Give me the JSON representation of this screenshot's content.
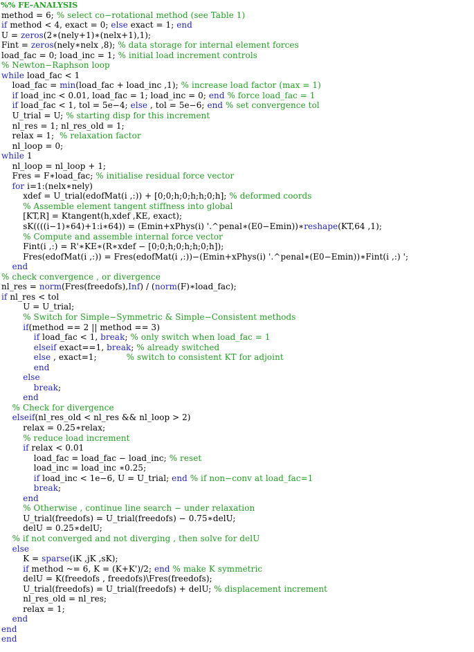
{
  "document": {
    "kind": "matlab-code-listing",
    "language": "MATLAB",
    "background_color": "#ffffff",
    "colors": {
      "plain": "#000000",
      "keyword": "#2222cc",
      "function": "#2222cc",
      "comment": "#1fa01f"
    },
    "cell_header": "%% FE–ANALYSIS",
    "line_count": 64
  },
  "lines": [
    {
      "indent": 0,
      "tokens": [
        {
          "t": "c",
          "v": "%% FE–ANALYSIS"
        }
      ]
    },
    {
      "indent": 0,
      "tokens": [
        {
          "t": "n",
          "v": "method = 6; "
        },
        {
          "t": "c",
          "v": "% select co−rotational method (see Table 1)"
        }
      ]
    },
    {
      "indent": 0,
      "tokens": [
        {
          "t": "k",
          "v": "if"
        },
        {
          "t": "n",
          "v": " method < 4, exact = 0; "
        },
        {
          "t": "k",
          "v": "else"
        },
        {
          "t": "n",
          "v": " exact = 1; "
        },
        {
          "t": "k",
          "v": "end"
        }
      ]
    },
    {
      "indent": 0,
      "tokens": [
        {
          "t": "n",
          "v": "U = "
        },
        {
          "t": "f",
          "v": "zeros"
        },
        {
          "t": "n",
          "v": "(2∗(nely+1)∗(nelx+1),1);"
        }
      ]
    },
    {
      "indent": 0,
      "tokens": [
        {
          "t": "n",
          "v": "Fint = "
        },
        {
          "t": "f",
          "v": "zeros"
        },
        {
          "t": "n",
          "v": "(nely∗nelx ,8); "
        },
        {
          "t": "c",
          "v": "% data storage for internal element forces"
        }
      ]
    },
    {
      "indent": 0,
      "tokens": [
        {
          "t": "n",
          "v": "load_fac = 0; load_inc = 1; "
        },
        {
          "t": "c",
          "v": "% initial load increment controls"
        }
      ]
    },
    {
      "indent": 0,
      "tokens": [
        {
          "t": "c",
          "v": "% Newton−Raphson loop"
        }
      ]
    },
    {
      "indent": 0,
      "tokens": [
        {
          "t": "k",
          "v": "while"
        },
        {
          "t": "n",
          "v": " load_fac < 1"
        }
      ]
    },
    {
      "indent": 1,
      "tokens": [
        {
          "t": "n",
          "v": "load_fac = "
        },
        {
          "t": "f",
          "v": "min"
        },
        {
          "t": "n",
          "v": "(load_fac + load_inc ,1); "
        },
        {
          "t": "c",
          "v": "% increase load factor (max = 1)"
        }
      ]
    },
    {
      "indent": 1,
      "tokens": [
        {
          "t": "k",
          "v": "if"
        },
        {
          "t": "n",
          "v": " load_inc < 0.01, load_fac = 1; load_inc = 0; "
        },
        {
          "t": "k",
          "v": "end"
        },
        {
          "t": "c",
          "v": " % force load_fac = 1"
        }
      ]
    },
    {
      "indent": 1,
      "tokens": [
        {
          "t": "k",
          "v": "if"
        },
        {
          "t": "n",
          "v": " load_fac < 1, tol = 5e−4; "
        },
        {
          "t": "k",
          "v": "else"
        },
        {
          "t": "n",
          "v": " , tol = 5e−6; "
        },
        {
          "t": "k",
          "v": "end"
        },
        {
          "t": "c",
          "v": " % set convergence tol"
        }
      ]
    },
    {
      "indent": 1,
      "tokens": [
        {
          "t": "n",
          "v": "U_trial = U; "
        },
        {
          "t": "c",
          "v": "% starting disp for this increment"
        }
      ]
    },
    {
      "indent": 1,
      "tokens": [
        {
          "t": "n",
          "v": "nl_res = 1; nl_res_old = 1;"
        }
      ]
    },
    {
      "indent": 1,
      "tokens": [
        {
          "t": "n",
          "v": "relax = 1;  "
        },
        {
          "t": "c",
          "v": "% relaxation factor"
        }
      ]
    },
    {
      "indent": 1,
      "tokens": [
        {
          "t": "n",
          "v": "nl_loop = 0;"
        }
      ]
    },
    {
      "indent": 0,
      "tokens": [
        {
          "t": "k",
          "v": "while"
        },
        {
          "t": "n",
          "v": " 1"
        }
      ]
    },
    {
      "indent": 1,
      "tokens": [
        {
          "t": "n",
          "v": "nl_loop = nl_loop + 1;"
        }
      ]
    },
    {
      "indent": 1,
      "tokens": [
        {
          "t": "n",
          "v": "Fres = F∗load_fac; "
        },
        {
          "t": "c",
          "v": "% initialise residual force vector"
        }
      ]
    },
    {
      "indent": 1,
      "tokens": [
        {
          "t": "k",
          "v": "for"
        },
        {
          "t": "n",
          "v": " i=1:(nelx∗nely)"
        }
      ]
    },
    {
      "indent": 2,
      "tokens": [
        {
          "t": "n",
          "v": "xdef = U_trial(edofMat(i ,:)) + [0;0;h;0;h;h;0;h]; "
        },
        {
          "t": "c",
          "v": "% deformed coords"
        }
      ]
    },
    {
      "indent": 2,
      "tokens": [
        {
          "t": "c",
          "v": "% Assemble element tangent stiffness into global"
        }
      ]
    },
    {
      "indent": 2,
      "tokens": [
        {
          "t": "n",
          "v": "[KT,R] = Ktangent(h,xdef ,KE, exact);"
        }
      ]
    },
    {
      "indent": 2,
      "tokens": [
        {
          "t": "n",
          "v": "sK((((i−1)∗64)+1:i∗64)) = (Emin+xPhys(i) '.^penal∗(E0−Emin))∗"
        },
        {
          "t": "f",
          "v": "reshape"
        },
        {
          "t": "n",
          "v": "(KT,64 ,1);"
        }
      ]
    },
    {
      "indent": 2,
      "tokens": [
        {
          "t": "c",
          "v": "% Compute and assemble internal force vector"
        }
      ]
    },
    {
      "indent": 2,
      "tokens": [
        {
          "t": "n",
          "v": "Fint(i ,:) = R'∗KE∗(R∗xdef − [0;0;h;0;h;h;0;h]);"
        }
      ]
    },
    {
      "indent": 2,
      "tokens": [
        {
          "t": "n",
          "v": "Fres(edofMat(i ,:)) = Fres(edofMat(i ,:))−(Emin+xPhys(i) '.^penal∗(E0−Emin))∗Fint(i ,:) ';"
        }
      ]
    },
    {
      "indent": 1,
      "tokens": [
        {
          "t": "k",
          "v": "end"
        }
      ]
    },
    {
      "indent": 0,
      "tokens": [
        {
          "t": "c",
          "v": "% check convergence , or divergence"
        }
      ]
    },
    {
      "indent": 0,
      "tokens": [
        {
          "t": "n",
          "v": "nl_res = "
        },
        {
          "t": "f",
          "v": "norm"
        },
        {
          "t": "n",
          "v": "(Fres(freedofs),"
        },
        {
          "t": "f",
          "v": "Inf"
        },
        {
          "t": "n",
          "v": ") / ("
        },
        {
          "t": "f",
          "v": "norm"
        },
        {
          "t": "n",
          "v": "(F)∗load_fac);"
        }
      ]
    },
    {
      "indent": 0,
      "tokens": [
        {
          "t": "k",
          "v": "if"
        },
        {
          "t": "n",
          "v": " nl_res < tol"
        }
      ]
    },
    {
      "indent": 2,
      "tokens": [
        {
          "t": "n",
          "v": "U = U_trial;"
        }
      ]
    },
    {
      "indent": 2,
      "tokens": [
        {
          "t": "c",
          "v": "% Switch for Simple−Symmetric & Simple−Consistent methods"
        }
      ]
    },
    {
      "indent": 2,
      "tokens": [
        {
          "t": "k",
          "v": "if"
        },
        {
          "t": "n",
          "v": "(method == 2 || method == 3)"
        }
      ]
    },
    {
      "indent": 3,
      "tokens": [
        {
          "t": "k",
          "v": "if"
        },
        {
          "t": "n",
          "v": " load_fac < 1, "
        },
        {
          "t": "k",
          "v": "break"
        },
        {
          "t": "n",
          "v": "; "
        },
        {
          "t": "c",
          "v": "% only switch when load_fac = 1"
        }
      ]
    },
    {
      "indent": 3,
      "tokens": [
        {
          "t": "k",
          "v": "elseif"
        },
        {
          "t": "n",
          "v": " exact==1, "
        },
        {
          "t": "k",
          "v": "break"
        },
        {
          "t": "n",
          "v": "; "
        },
        {
          "t": "c",
          "v": "% already switched"
        }
      ]
    },
    {
      "indent": 3,
      "tokens": [
        {
          "t": "k",
          "v": "else"
        },
        {
          "t": "n",
          "v": " , exact=1;           "
        },
        {
          "t": "c",
          "v": "% switch to consistent KT for adjoint"
        }
      ]
    },
    {
      "indent": 3,
      "tokens": [
        {
          "t": "k",
          "v": "end"
        }
      ]
    },
    {
      "indent": 2,
      "tokens": [
        {
          "t": "k",
          "v": "else"
        }
      ]
    },
    {
      "indent": 3,
      "tokens": [
        {
          "t": "k",
          "v": "break"
        },
        {
          "t": "n",
          "v": ";"
        }
      ]
    },
    {
      "indent": 2,
      "tokens": [
        {
          "t": "k",
          "v": "end"
        }
      ]
    },
    {
      "indent": 1,
      "tokens": [
        {
          "t": "c",
          "v": "% Check for divergence"
        }
      ]
    },
    {
      "indent": 1,
      "tokens": [
        {
          "t": "k",
          "v": "elseif"
        },
        {
          "t": "n",
          "v": "(nl_res_old < nl_res && nl_loop > 2)"
        }
      ]
    },
    {
      "indent": 2,
      "tokens": [
        {
          "t": "n",
          "v": "relax = 0.25∗relax;"
        }
      ]
    },
    {
      "indent": 2,
      "tokens": [
        {
          "t": "c",
          "v": "% reduce load increment"
        }
      ]
    },
    {
      "indent": 2,
      "tokens": [
        {
          "t": "k",
          "v": "if"
        },
        {
          "t": "n",
          "v": " relax < 0.01"
        }
      ]
    },
    {
      "indent": 3,
      "tokens": [
        {
          "t": "n",
          "v": "load_fac = load_fac − load_inc; "
        },
        {
          "t": "c",
          "v": "% reset"
        }
      ]
    },
    {
      "indent": 3,
      "tokens": [
        {
          "t": "n",
          "v": "load_inc = load_inc ∗0.25;"
        }
      ]
    },
    {
      "indent": 3,
      "tokens": [
        {
          "t": "k",
          "v": "if"
        },
        {
          "t": "n",
          "v": " load_inc < 1e−6, U = U_trial; "
        },
        {
          "t": "k",
          "v": "end"
        },
        {
          "t": "c",
          "v": " % if non−conv at load_fac=1"
        }
      ]
    },
    {
      "indent": 3,
      "tokens": [
        {
          "t": "k",
          "v": "break"
        },
        {
          "t": "n",
          "v": ";"
        }
      ]
    },
    {
      "indent": 2,
      "tokens": [
        {
          "t": "k",
          "v": "end"
        }
      ]
    },
    {
      "indent": 2,
      "tokens": [
        {
          "t": "c",
          "v": "% Otherwise , continue line search − under relaxation"
        }
      ]
    },
    {
      "indent": 2,
      "tokens": [
        {
          "t": "n",
          "v": "U_trial(freedofs) = U_trial(freedofs) − 0.75∗delU;"
        }
      ]
    },
    {
      "indent": 2,
      "tokens": [
        {
          "t": "n",
          "v": "delU = 0.25∗delU;"
        }
      ]
    },
    {
      "indent": 1,
      "tokens": [
        {
          "t": "c",
          "v": "% if not converged and not diverging , then solve for delU"
        }
      ]
    },
    {
      "indent": 1,
      "tokens": [
        {
          "t": "k",
          "v": "else"
        }
      ]
    },
    {
      "indent": 2,
      "tokens": [
        {
          "t": "n",
          "v": "K = "
        },
        {
          "t": "f",
          "v": "sparse"
        },
        {
          "t": "n",
          "v": "(iK ,jK ,sK);"
        }
      ]
    },
    {
      "indent": 2,
      "tokens": [
        {
          "t": "k",
          "v": "if"
        },
        {
          "t": "n",
          "v": " method ~= 6, K = (K+K')/2; "
        },
        {
          "t": "k",
          "v": "end"
        },
        {
          "t": "c",
          "v": " % make K symmetric"
        }
      ]
    },
    {
      "indent": 2,
      "tokens": [
        {
          "t": "n",
          "v": "delU = K(freedofs , freedofs)\\Fres(freedofs);"
        }
      ]
    },
    {
      "indent": 2,
      "tokens": [
        {
          "t": "n",
          "v": "U_trial(freedofs) = U_trial(freedofs) + delU; "
        },
        {
          "t": "c",
          "v": "% displacement increment"
        }
      ]
    },
    {
      "indent": 2,
      "tokens": [
        {
          "t": "n",
          "v": "nl_res_old = nl_res;"
        }
      ]
    },
    {
      "indent": 2,
      "tokens": [
        {
          "t": "n",
          "v": "relax = 1;"
        }
      ]
    },
    {
      "indent": 1,
      "tokens": [
        {
          "t": "k",
          "v": "end"
        }
      ]
    },
    {
      "indent": 0,
      "tokens": [
        {
          "t": "k",
          "v": "end"
        }
      ]
    },
    {
      "indent": 0,
      "tokens": [
        {
          "t": "k",
          "v": "end"
        }
      ]
    }
  ]
}
